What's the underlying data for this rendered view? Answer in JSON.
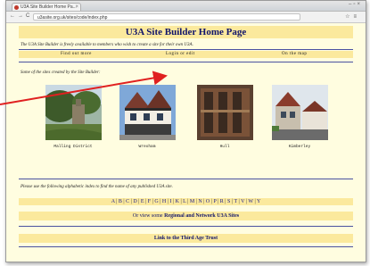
{
  "browser": {
    "tab_title": "U3A Site Builder Home Pa...",
    "url": "u3asite.org.uk/sites/code/index.php"
  },
  "page": {
    "title": "U3A Site Builder Home Page",
    "intro": "The U3A Site Builder is freely available to members who wish to create a site for their own U3A.",
    "buttons": [
      "Find out more",
      "Login or edit",
      "On the map"
    ],
    "sites_label": "Some of the sites created by the Site Builder:",
    "sites": [
      {
        "caption": "Malling District"
      },
      {
        "caption": "Wrexham"
      },
      {
        "caption": "Hull"
      },
      {
        "caption": "Kimberley"
      }
    ],
    "index_label": "Please use the following alphabetic index to find the name of any published U3A site.",
    "letters": [
      "A",
      "B",
      "C",
      "D",
      "E",
      "F",
      "G",
      "H",
      "I",
      "K",
      "L",
      "M",
      "N",
      "O",
      "P",
      "R",
      "S",
      "T",
      "V",
      "W",
      "Y"
    ],
    "regional_prefix": "Or view some",
    "regional_link": "Regional and Network U3A Sites",
    "trust_link": "Link to the Third Age Trust"
  },
  "colors": {
    "band": "#fbe99d",
    "page_bg": "#fffde0",
    "heading": "#10146b",
    "annotation_arrow": "#e02020"
  }
}
